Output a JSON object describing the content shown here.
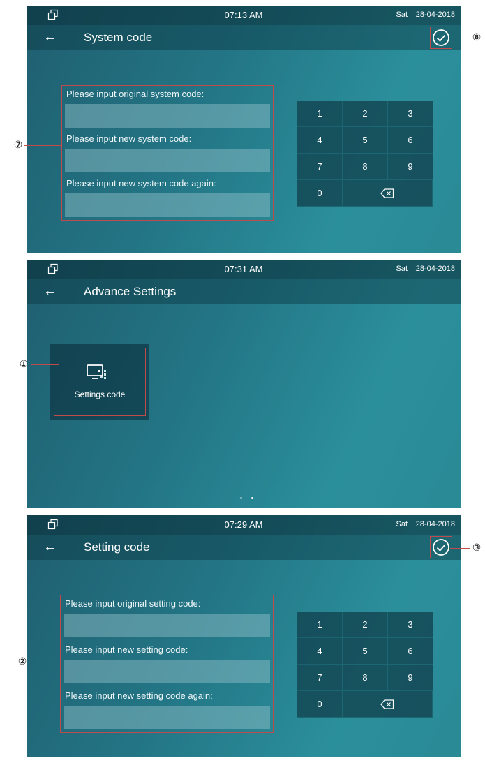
{
  "screens": [
    {
      "statusbar": {
        "time": "07:13 AM",
        "day": "Sat",
        "date": "28-04-2018"
      },
      "title": "System code",
      "fields": [
        {
          "label": "Please input original system code:",
          "value": ""
        },
        {
          "label": "Please input new system code:",
          "value": ""
        },
        {
          "label": "Please input new system code again:",
          "value": ""
        }
      ],
      "callouts": {
        "form": "⑦",
        "confirm": "⑧"
      }
    },
    {
      "statusbar": {
        "time": "07:31 AM",
        "day": "Sat",
        "date": "28-04-2018"
      },
      "title": "Advance Settings",
      "tile": {
        "label": "Settings code"
      },
      "callouts": {
        "tile": "①"
      }
    },
    {
      "statusbar": {
        "time": "07:29 AM",
        "day": "Sat",
        "date": "28-04-2018"
      },
      "title": "Setting code",
      "fields": [
        {
          "label": "Please input original setting code:",
          "value": ""
        },
        {
          "label": "Please input new setting code:",
          "value": ""
        },
        {
          "label": "Please input new setting code again:",
          "value": ""
        }
      ],
      "callouts": {
        "form": "②",
        "confirm": "③"
      }
    }
  ],
  "keypad": {
    "keys": [
      "1",
      "2",
      "3",
      "4",
      "5",
      "6",
      "7",
      "8",
      "9",
      "0"
    ],
    "backspace_icon": "backspace-icon"
  },
  "icons": {
    "window": "window-icon",
    "back": "back-arrow-icon",
    "confirm": "check-circle-icon",
    "tile": "monitor-settings-icon"
  },
  "colors": {
    "highlight": "#c14a4a",
    "screen_bg": "#237585",
    "bar_bg": "#0c3742"
  }
}
